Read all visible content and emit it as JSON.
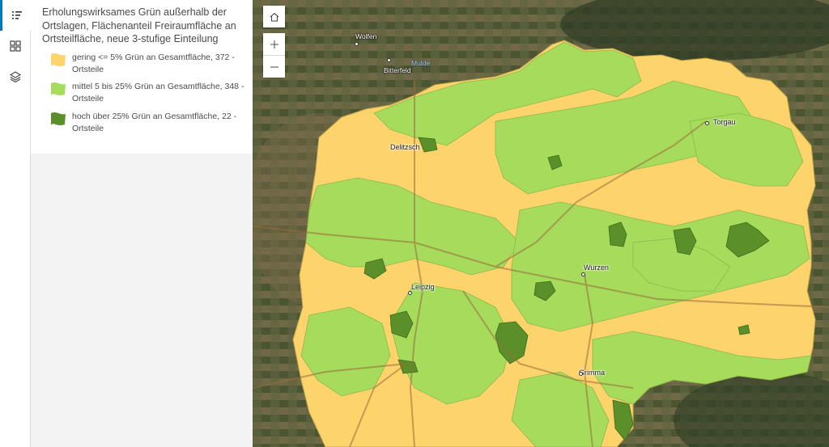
{
  "legend": {
    "title": "Erholungswirksames Grün außerhalb der Ortslagen, Flächenanteil Freiraumfläche an Ortsteilfläche, neue 3-stufige Einteilung",
    "items": [
      {
        "label": "gering <= 5% Grün an Gesamtfläche, 372 - Ortsteile",
        "color": "#fdd36b"
      },
      {
        "label": "mittel 5 bis 25% Grün an Gesamtfläche, 348 - Ortsteile",
        "color": "#a6db5c"
      },
      {
        "label": "hoch über 25% Grün an Gesamtfläche, 22 - Ortsteile",
        "color": "#5a8f2a"
      }
    ]
  },
  "rail": {
    "icons": [
      "legend-icon",
      "basemap-gallery-icon",
      "layers-icon"
    ]
  },
  "map_controls": {
    "icons": [
      "home-icon",
      "zoom-in-icon",
      "zoom-out-icon"
    ]
  },
  "places": {
    "wolfen": "Wolfen",
    "bitterfeld": "Bitterfeld",
    "mulde": "Mulde",
    "delitzsch": "Delitzsch",
    "torgau": "Torgau",
    "leipzig": "Leipzig",
    "wurzen": "Wurzen",
    "grimma": "Grimma"
  },
  "colors": {
    "accent": "#0079c1",
    "low": "#fdd36b",
    "mid": "#a6db5c",
    "high": "#5a8f2a",
    "imagery": "#5c5a3c"
  }
}
